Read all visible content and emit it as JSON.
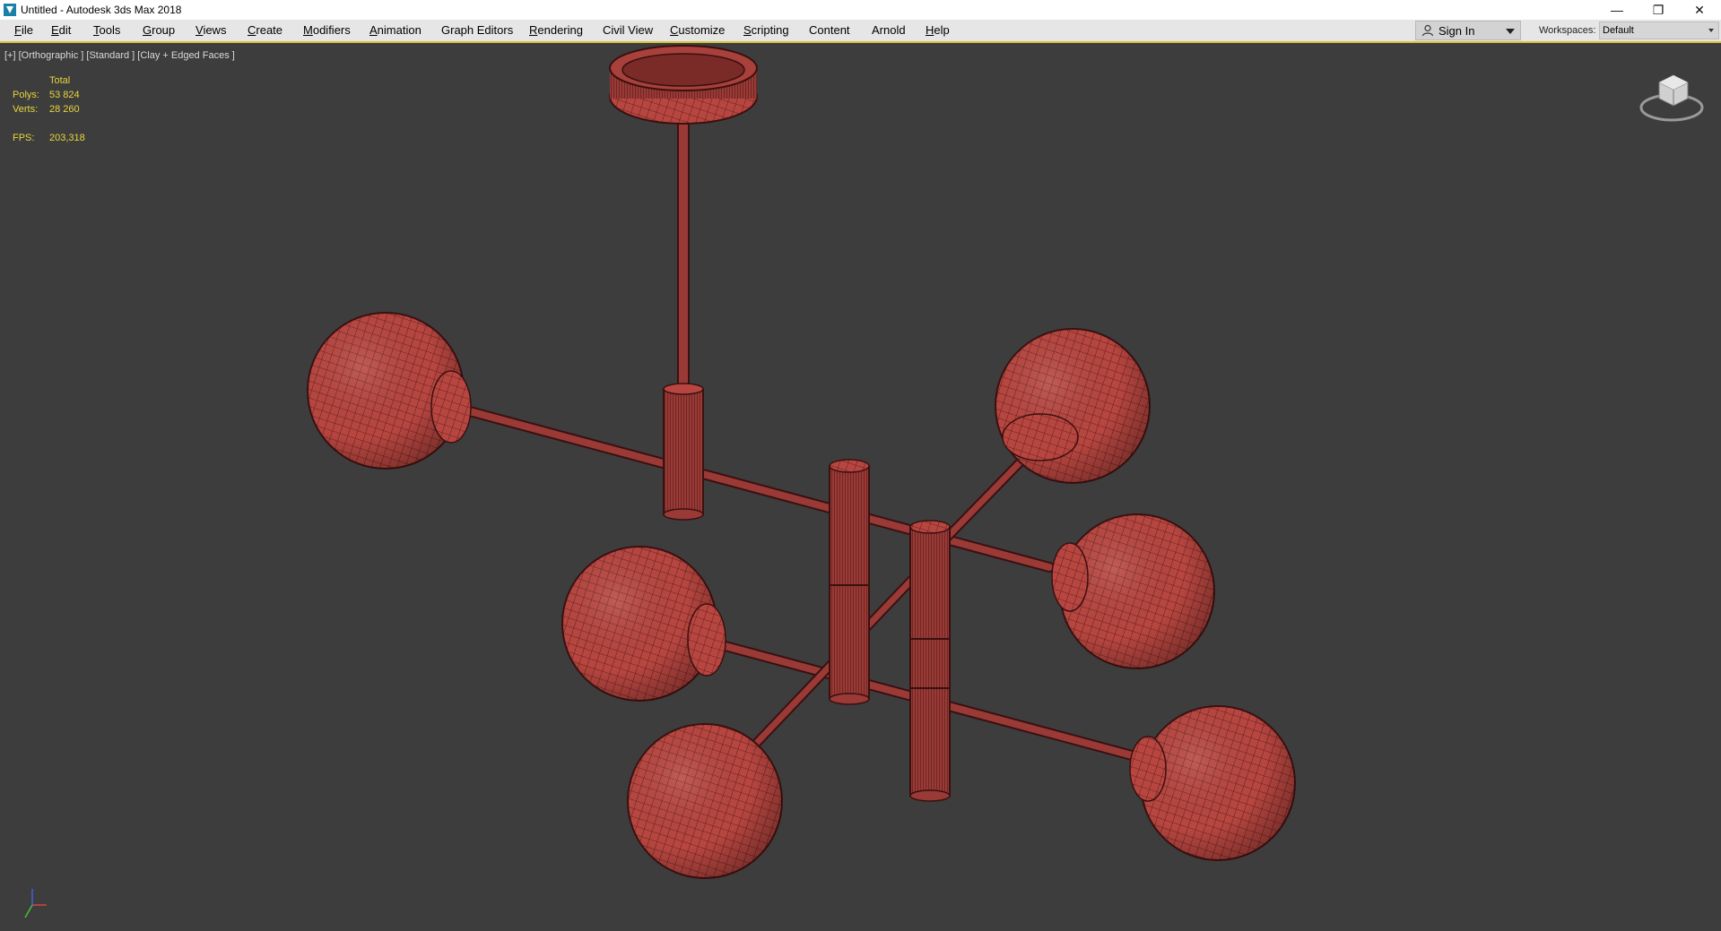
{
  "window": {
    "title": "Untitled - Autodesk 3ds Max 2018",
    "controls": {
      "minimize": "—",
      "restore": "❐",
      "close": "✕"
    }
  },
  "menu": [
    {
      "label": "File",
      "mn": "F",
      "rest": "ile"
    },
    {
      "label": "Edit",
      "mn": "E",
      "rest": "dit"
    },
    {
      "label": "Tools",
      "mn": "T",
      "rest": "ools"
    },
    {
      "label": "Group",
      "mn": "G",
      "rest": "roup"
    },
    {
      "label": "Views",
      "mn": "V",
      "rest": "iews"
    },
    {
      "label": "Create",
      "mn": "C",
      "rest": "reate"
    },
    {
      "label": "Modifiers",
      "mn": "M",
      "rest": "odifiers"
    },
    {
      "label": "Animation",
      "mn": "A",
      "rest": "nimation"
    },
    {
      "label": "Graph Editors",
      "mn": "",
      "rest": "Graph Editors"
    },
    {
      "label": "Rendering",
      "mn": "R",
      "rest": "endering"
    },
    {
      "label": "Civil View",
      "mn": "",
      "rest": "Civil View"
    },
    {
      "label": "Customize",
      "mn": "C",
      "rest": "ustomize"
    },
    {
      "label": "Scripting",
      "mn": "S",
      "rest": "cripting"
    },
    {
      "label": "Content",
      "mn": "",
      "rest": "Content"
    },
    {
      "label": "Arnold",
      "mn": "",
      "rest": "Arnold"
    },
    {
      "label": "Help",
      "mn": "H",
      "rest": "elp"
    }
  ],
  "account": {
    "sign_in": "Sign In"
  },
  "workspaces": {
    "label": "Workspaces:",
    "value": "Default"
  },
  "viewport": {
    "label": "[+] [Orthographic ] [Standard ] [Clay + Edged Faces ]",
    "stats": {
      "header": "Total",
      "polys_label": "Polys:",
      "polys": "53 824",
      "verts_label": "Verts:",
      "verts": "28 260",
      "fps_label": "FPS:",
      "fps": "203,318"
    },
    "colors": {
      "background": "#3d3d3d",
      "clay": "#b84640",
      "wire": "#4a1414",
      "stats_text": "#e8d63c",
      "active_border": "#d9c43a"
    }
  },
  "icons": {
    "app": "3dsmax-app-icon",
    "user": "user-icon",
    "viewcube": "viewcube-icon",
    "axis": "axis-tripod-icon"
  }
}
